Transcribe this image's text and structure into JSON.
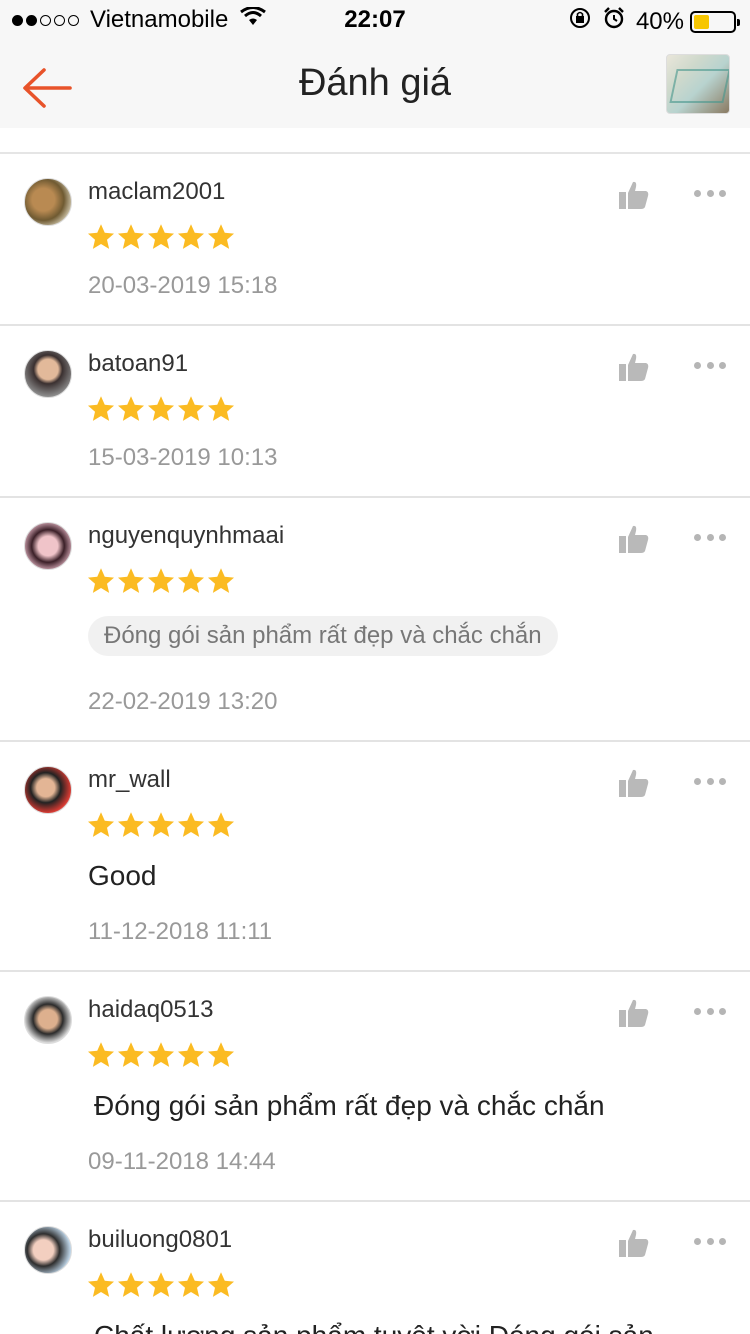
{
  "status_bar": {
    "carrier": "Vietnamobile",
    "time": "22:07",
    "battery_percent": "40%",
    "battery_level": 0.4,
    "signal_bars_filled": 2,
    "signal_bars_total": 5
  },
  "header": {
    "title": "Đánh giá",
    "back_icon": "arrow-left-icon",
    "accent_color": "#e8532a"
  },
  "colors": {
    "star": "#fbbb22",
    "like_icon": "#b9b9b9"
  },
  "reviews": [
    {
      "username": "maclam2001",
      "rating": 5,
      "date": "20-03-2019 15:18"
    },
    {
      "username": "batoan91",
      "rating": 5,
      "date": "15-03-2019 10:13"
    },
    {
      "username": "nguyenquynhmaai",
      "rating": 5,
      "tag": "Đóng gói sản phẩm rất đẹp và chắc chắn",
      "date": "22-02-2019 13:20"
    },
    {
      "username": "mr_wall",
      "rating": 5,
      "comment": "Good",
      "date": "11-12-2018 11:11"
    },
    {
      "username": "haidaq0513",
      "rating": 5,
      "comment": "Đóng gói sản phẩm rất đẹp và chắc chắn",
      "date": "09-11-2018 14:44"
    },
    {
      "username": "builuong0801",
      "rating": 5,
      "comment": "Chất lượng sản phẩm tuyệt vời Đóng gói sản"
    }
  ]
}
